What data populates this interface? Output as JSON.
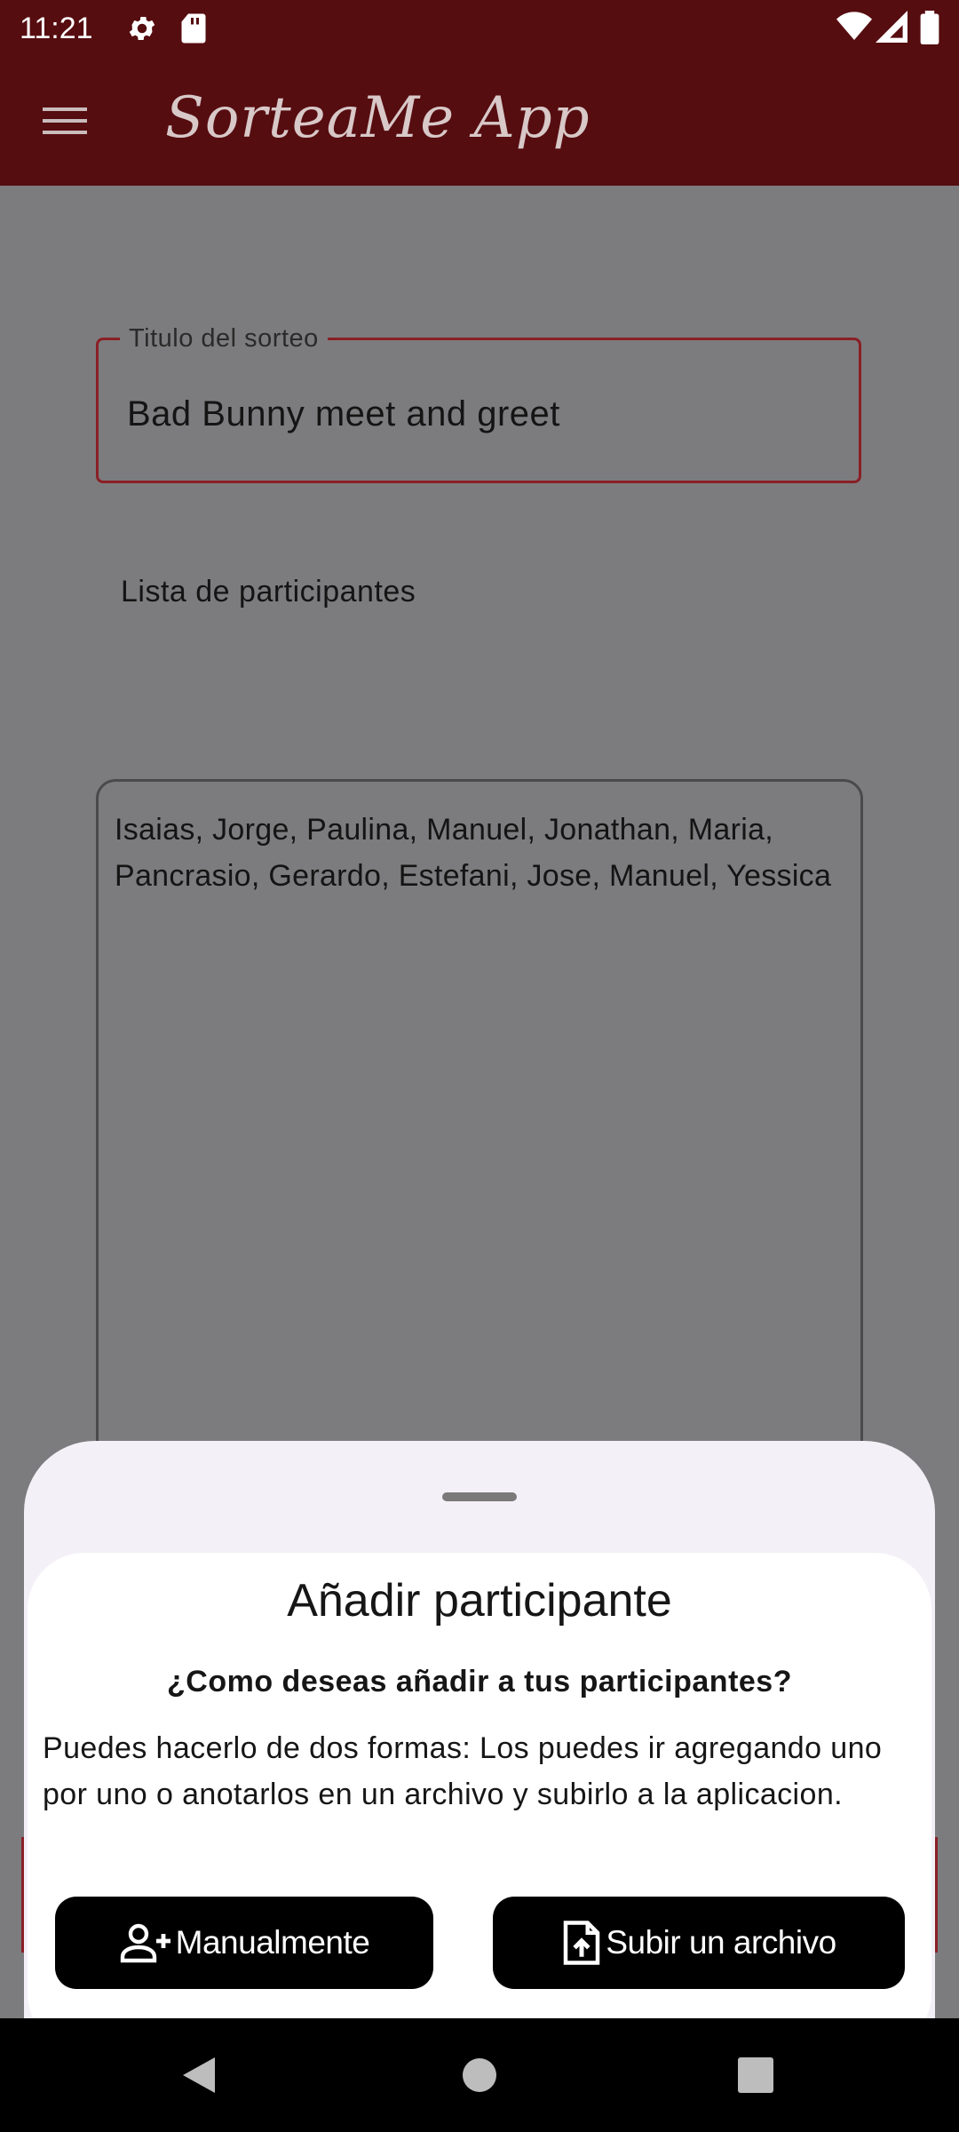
{
  "status_bar": {
    "time": "11:21",
    "icons": [
      "settings-icon",
      "sd-card-icon",
      "wifi-icon",
      "signal-icon",
      "battery-icon"
    ]
  },
  "app_bar": {
    "title": "SorteaMe App",
    "menu_icon": "menu-icon",
    "background_color": "#560d10"
  },
  "form": {
    "title_field": {
      "label": "Titulo del sorteo",
      "value": "Bad Bunny meet and greet"
    },
    "participants_label": "Lista de participantes",
    "participants_value": "Isaias, Jorge, Paulina, Manuel, Jonathan, Maria, Pancrasio, Gerardo, Estefani, Jose, Manuel, Yessica"
  },
  "bottom_sheet": {
    "title": "Añadir participante",
    "question": "¿Como deseas añadir a tus participantes?",
    "description": "Puedes hacerlo de dos formas: Los puedes ir agregando uno por uno o anotarlos en un archivo y subirlo a la aplicacion.",
    "buttons": [
      {
        "label": "Manualmente",
        "icon": "add-person-icon"
      },
      {
        "label": "Subir un archivo",
        "icon": "file-upload-icon"
      }
    ]
  },
  "nav_bar": {
    "icons": [
      "back-icon",
      "home-icon",
      "recents-icon"
    ]
  },
  "colors": {
    "primary": "#560d10",
    "accent_border": "#8a1f26",
    "scrim": "#7c7c7e",
    "button": "#000000",
    "sheet": "#f4f0f7"
  }
}
